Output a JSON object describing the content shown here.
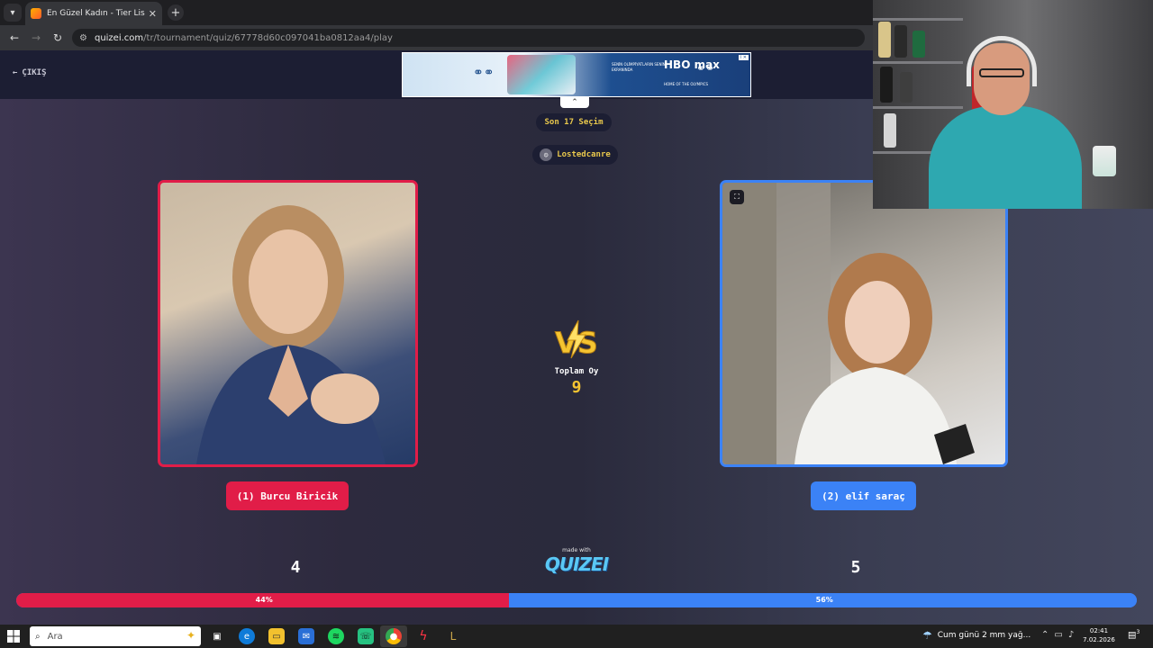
{
  "browser": {
    "tab_title": "En Güzel Kadın - Tier List, Kör S",
    "tab_close": "✕",
    "new_tab": "+",
    "url_host": "quizei.com",
    "url_path": "/tr/tournament/quiz/67778d60c097041ba0812aa4/play"
  },
  "header": {
    "exit_label": "ÇIKIŞ"
  },
  "ad": {
    "small_text": "SENİN OLİMPİYATLARIN SENİN EKRANINDA",
    "brand": "HBO max",
    "tagline": "HOME OF THE OLYMPICS",
    "info": "i ✕"
  },
  "status": {
    "remaining": "Son 17 Seçim",
    "player": "Lostedcanre"
  },
  "contest": {
    "left_name": "(1) Burcu Biricik",
    "right_name": "(2) elif saraç",
    "total_label": "Toplam Oy",
    "total_value": "9",
    "left_votes": "4",
    "right_votes": "5",
    "left_percent": 44,
    "right_percent": 56,
    "left_percent_label": "44%",
    "right_percent_label": "56%",
    "left_color": "#e11d48",
    "right_color": "#3b82f6"
  },
  "footer": {
    "made_with": "made with",
    "logo": "QUIZEI"
  },
  "taskbar": {
    "search_placeholder": "Ara",
    "weather": "Cum günü 2 mm yağ...",
    "time": "02:41",
    "date": "7.02.2026",
    "notif_count": "3"
  },
  "icons": {
    "back": "back-arrow-icon",
    "forward": "forward-arrow-icon",
    "reload": "reload-icon",
    "expand": "expand-icon",
    "vs": "vs-lightning-icon"
  }
}
